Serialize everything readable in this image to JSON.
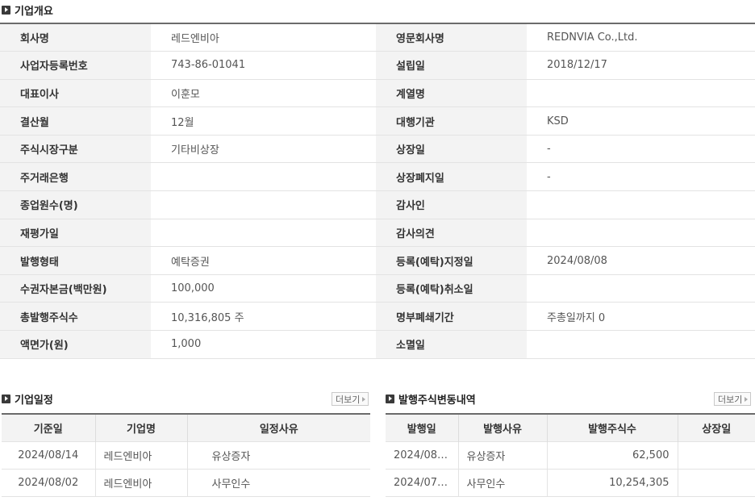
{
  "overview": {
    "title": "기업개요",
    "rows": [
      [
        "회사명",
        "레드엔비아",
        "영문회사명",
        "REDNVIA Co.,Ltd."
      ],
      [
        "사업자등록번호",
        "743-86-01041",
        "설립일",
        "2018/12/17"
      ],
      [
        "대표이사",
        "이훈모",
        "계열명",
        ""
      ],
      [
        "결산월",
        "12월",
        "대행기관",
        "KSD"
      ],
      [
        "주식시장구분",
        "기타비상장",
        "상장일",
        "-"
      ],
      [
        "주거래은행",
        "",
        "상장폐지일",
        "-"
      ],
      [
        "종업원수(명)",
        "",
        "감사인",
        ""
      ],
      [
        "재평가일",
        "",
        "감사의견",
        ""
      ],
      [
        "발행형태",
        "예탁증권",
        "등록(예탁)지정일",
        "2024/08/08"
      ],
      [
        "수권자본금(백만원)",
        "100,000",
        "등록(예탁)취소일",
        ""
      ],
      [
        "총발행주식수",
        "10,316,805 주",
        "명부폐쇄기간",
        "주총일까지 0"
      ],
      [
        "액면가(원)",
        "1,000",
        "소멸일",
        ""
      ]
    ]
  },
  "schedule": {
    "title": "기업일정",
    "more_label": "더보기",
    "headers": [
      "기준일",
      "기업명",
      "일정사유"
    ],
    "rows": [
      [
        "2024/08/14",
        "레드엔비아",
        "유상증자"
      ],
      [
        "2024/08/02",
        "레드엔비아",
        "사무인수"
      ]
    ]
  },
  "shares": {
    "title": "발행주식변동내역",
    "more_label": "더보기",
    "headers": [
      "발행일",
      "발행사유",
      "발행주식수",
      "상장일"
    ],
    "rows": [
      [
        "2024/08…",
        "유상증자",
        "62,500",
        ""
      ],
      [
        "2024/07…",
        "사무인수",
        "10,254,305",
        ""
      ]
    ]
  }
}
